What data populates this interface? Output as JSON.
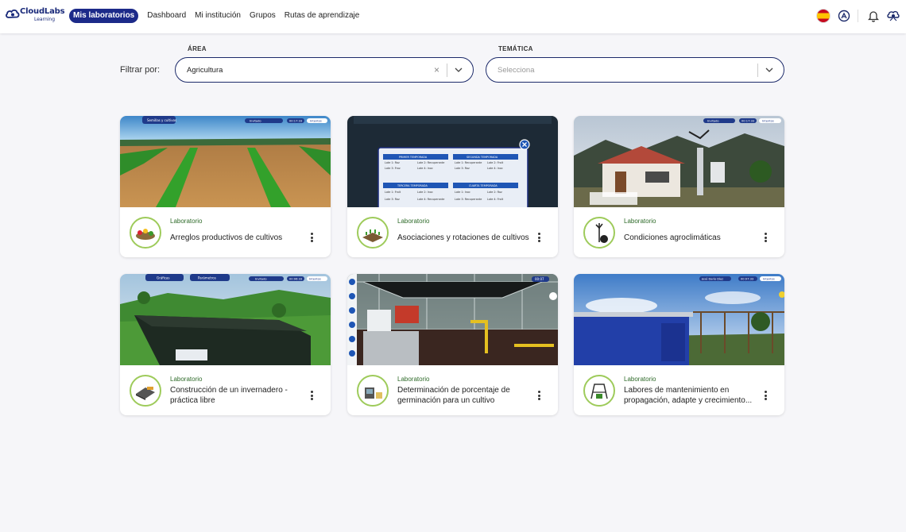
{
  "brand": {
    "name": "CloudLabs",
    "sub": "Learning"
  },
  "nav": {
    "items": [
      {
        "label": "Mis laboratorios",
        "active": true
      },
      {
        "label": "Dashboard",
        "active": false
      },
      {
        "label": "Mi institución",
        "active": false
      },
      {
        "label": "Grupos",
        "active": false
      },
      {
        "label": "Rutas de aprendizaje",
        "active": false
      }
    ]
  },
  "header_icons": [
    "spain-flag-icon",
    "accessibility-icon",
    "bell-icon",
    "user-menu-icon"
  ],
  "filters": {
    "label": "Filtrar por:",
    "area": {
      "label": "ÁREA",
      "value": "Agricultura"
    },
    "tematica": {
      "label": "TEMÁTICA",
      "placeholder": "Selecciona"
    }
  },
  "labs": [
    {
      "kind": "Laboratorio",
      "title": "Arreglos productivos de cultivos"
    },
    {
      "kind": "Laboratorio",
      "title": "Asociaciones y rotaciones de cultivos"
    },
    {
      "kind": "Laboratorio",
      "title": "Condiciones agroclimáticas"
    },
    {
      "kind": "Laboratorio",
      "title": "Construcción de un invernadero - práctica libre"
    },
    {
      "kind": "Laboratorio",
      "title": "Determinación de porcentaje de germinación para un cultivo"
    },
    {
      "kind": "Laboratorio",
      "title": "Labores de mantenimiento en propagación, adapte y crecimiento..."
    }
  ],
  "thumb_hud": {
    "card1": {
      "menu": "Semillas y cultivos",
      "badge": "Invitado",
      "timer": "00:17:33",
      "button": "Intentos"
    },
    "card2": {
      "seasons": [
        {
          "name": "PRIMER TEMPORADA",
          "cells": [
            "Lote 1: Roz",
            "Lote 2: Recuperante",
            "Lote 3: Froz",
            "Lote 4: Inoc"
          ]
        },
        {
          "name": "SEGUNDA TEMPORADA",
          "cells": [
            "Lote 1: Recuperante",
            "Lote 2: Frolt",
            "Lote 3: Roz",
            "Lote 4: Inoc"
          ]
        },
        {
          "name": "TERCERA TEMPORADA",
          "cells": [
            "Lote 1: Frolt",
            "Lote 2: Inoc",
            "Lote 3: Roz",
            "Lote 4: Recuperante"
          ]
        },
        {
          "name": "CUARTA TEMPORADA",
          "cells": [
            "Lote 1: Inoc",
            "Lote 2: Roz",
            "Lote 3: Recuperante",
            "Lote 4: Frolt"
          ]
        }
      ]
    },
    "card3": {
      "badge": "Invitado",
      "timer": "00:17:33",
      "button": "Intentos"
    },
    "card4": {
      "menu1": "Gráficas",
      "menu2": "Parámetros",
      "badge": "Invitado",
      "timer": "00:06:33",
      "button": "Intentos"
    },
    "card5": {
      "timer": "00:07"
    },
    "card6": {
      "badge": "José Darío Díaz",
      "timer": "00:07:33",
      "button": "Intentos"
    }
  }
}
